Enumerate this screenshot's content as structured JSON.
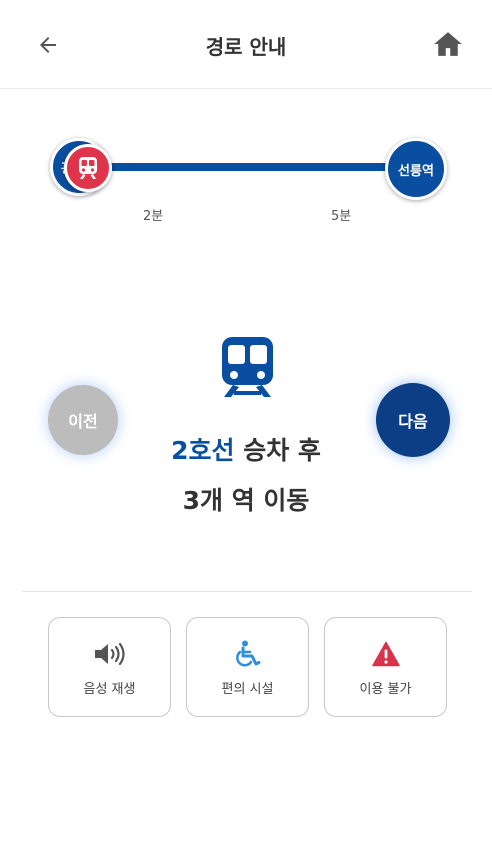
{
  "header": {
    "title": "경로 안내",
    "back_icon": "arrow-left-icon",
    "home_icon": "home-icon"
  },
  "route": {
    "start_station_label": "광",
    "end_station_label": "선릉역",
    "segment_times": [
      "2분",
      "5분"
    ],
    "current_marker_icon": "train-icon"
  },
  "instruction": {
    "line_name": "2호선",
    "line1_rest": " 승차 후",
    "line2": "3개 역 이동",
    "icon": "subway-icon"
  },
  "navigation": {
    "prev_label": "이전",
    "next_label": "다음"
  },
  "actions": [
    {
      "label": "음성 재생",
      "icon": "speaker-icon"
    },
    {
      "label": "편의 시설",
      "icon": "wheelchair-icon"
    },
    {
      "label": "이용 불가",
      "icon": "warning-icon"
    }
  ],
  "colors": {
    "line_blue": "#0a4ea0",
    "current_red": "#e0344b",
    "next_button": "#0b3e84",
    "prev_button": "#bcbcbc",
    "wheelchair_blue": "#2f8ddc",
    "warning_red": "#d8334a"
  }
}
